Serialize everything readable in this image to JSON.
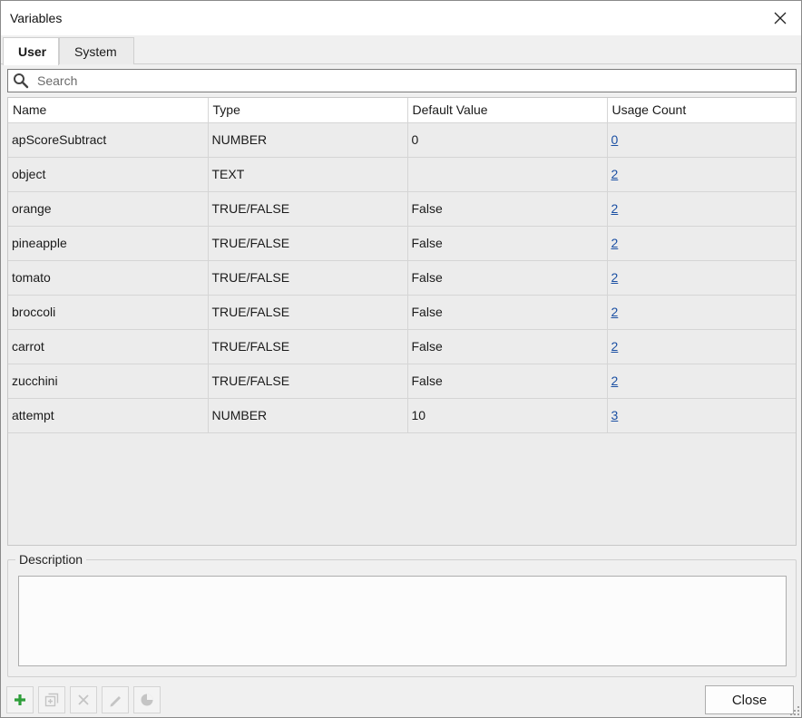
{
  "window": {
    "title": "Variables"
  },
  "tabs": [
    {
      "label": "User",
      "active": true
    },
    {
      "label": "System",
      "active": false
    }
  ],
  "search": {
    "placeholder": "Search",
    "value": ""
  },
  "table": {
    "columns": [
      "Name",
      "Type",
      "Default Value",
      "Usage Count"
    ],
    "rows": [
      {
        "name": "apScoreSubtract",
        "type": "NUMBER",
        "default": "0",
        "usage": "0"
      },
      {
        "name": "object",
        "type": "TEXT",
        "default": "",
        "usage": "2"
      },
      {
        "name": "orange",
        "type": "TRUE/FALSE",
        "default": "False",
        "usage": "2"
      },
      {
        "name": "pineapple",
        "type": "TRUE/FALSE",
        "default": "False",
        "usage": "2"
      },
      {
        "name": "tomato",
        "type": "TRUE/FALSE",
        "default": "False",
        "usage": "2"
      },
      {
        "name": "broccoli",
        "type": "TRUE/FALSE",
        "default": "False",
        "usage": "2"
      },
      {
        "name": "carrot",
        "type": "TRUE/FALSE",
        "default": "False",
        "usage": "2"
      },
      {
        "name": "zucchini",
        "type": "TRUE/FALSE",
        "default": "False",
        "usage": "2"
      },
      {
        "name": "attempt",
        "type": "NUMBER",
        "default": "10",
        "usage": "3"
      }
    ]
  },
  "description": {
    "label": "Description",
    "value": ""
  },
  "toolbar": {
    "buttons": [
      {
        "icon": "add-icon",
        "enabled": true
      },
      {
        "icon": "duplicate-icon",
        "enabled": false
      },
      {
        "icon": "delete-icon",
        "enabled": false
      },
      {
        "icon": "edit-icon",
        "enabled": false
      },
      {
        "icon": "usage-pie-icon",
        "enabled": false
      }
    ],
    "close_label": "Close"
  },
  "colors": {
    "link": "#1a4fa3",
    "add": "#2e9e3a",
    "disabled_icon": "#c4c4c4"
  }
}
